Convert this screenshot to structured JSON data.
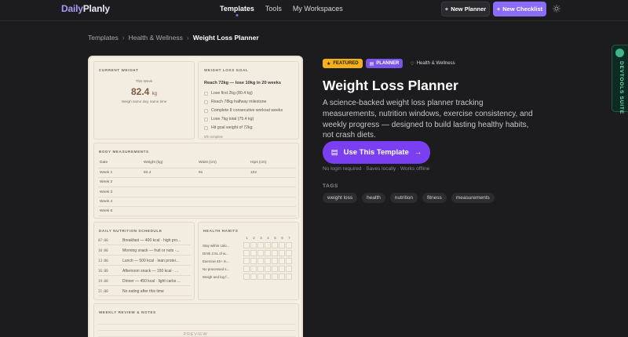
{
  "brand": {
    "part1": "Daily",
    "part2": "Planly"
  },
  "nav": {
    "links": [
      "Templates",
      "Tools",
      "My Workspaces"
    ],
    "new_planner": "New Planner",
    "new_checklist": "New Checklist"
  },
  "breadcrumb": [
    "Templates",
    "Health & Wellness",
    "Weight Loss Planner"
  ],
  "preview": {
    "current_weight": {
      "title": "CURRENT WEIGHT",
      "label": "This Week",
      "value": "82.4",
      "unit": "kg",
      "note": "Weigh same day, same time"
    },
    "goal": {
      "title": "WEIGHT LOSS GOAL",
      "headline": "Reach 72kg — lose 10kg in 20 weeks",
      "items": [
        "Lose first 2kg (80.4 kg)",
        "Reach 78kg halfway milestone",
        "Complete 8 consecutive workout weeks",
        "Lose 7kg total (75.4 kg)",
        "Hit goal weight of 72kg"
      ],
      "footer": "0/5 complete"
    },
    "measurements": {
      "title": "BODY MEASUREMENTS",
      "headers": [
        "Date",
        "Weight (kg)",
        "Waist (cm)",
        "Hips (cm)"
      ],
      "rows": [
        [
          "Week 1",
          "82.4",
          "91",
          "102"
        ],
        [
          "Week 2",
          "",
          "",
          ""
        ],
        [
          "Week 3",
          "",
          "",
          ""
        ],
        [
          "Week 4",
          "",
          "",
          ""
        ],
        [
          "Week 6",
          "",
          "",
          ""
        ]
      ]
    },
    "nutrition": {
      "title": "DAILY NUTRITION SCHEDULE",
      "rows": [
        {
          "time": "07:00",
          "text": "Breakfast — 400 kcal · high pro..."
        },
        {
          "time": "10:00",
          "text": "Morning snack — fruit or nuts ·..."
        },
        {
          "time": "13:00",
          "text": "Lunch — 500 kcal · lean protei..."
        },
        {
          "time": "16:00",
          "text": "Afternoon snack — 150 kcal · ..."
        },
        {
          "time": "19:00",
          "text": "Dinner — 450 kcal · light carbs ..."
        },
        {
          "time": "21:00",
          "text": "No eating after this time"
        }
      ]
    },
    "habits": {
      "title": "HEALTH HABITS",
      "days": [
        "1",
        "2",
        "3",
        "4",
        "5",
        "6",
        "7"
      ],
      "rows": [
        "Stay within calo...",
        "Drink 2.5L of w...",
        "Exercise 45+ m...",
        "No processed s...",
        "Weigh and log f..."
      ]
    },
    "review": {
      "title": "WEEKLY REVIEW & NOTES"
    },
    "watermark": "PREVIEW"
  },
  "detail": {
    "badges": {
      "featured": "FEATURED",
      "planner": "PLANNER",
      "category": "Health & Wellness"
    },
    "title": "Weight Loss Planner",
    "description": "A science-backed weight loss planner tracking measurements, nutrition windows, exercise consistency, and weekly progress — designed to build lasting healthy habits, not crash diets.",
    "cta": "Use This Template",
    "cta_sub": "No login required · Saves locally · Works offline",
    "tags_label": "TAGS",
    "tags": [
      "weight loss",
      "health",
      "nutrition",
      "fitness",
      "measurements"
    ]
  },
  "devtools": {
    "label": "DEVTOOLS SUITE"
  },
  "colors": {
    "accent": "#8b6cf6",
    "cta": "#7b3ff2",
    "featured": "#f3b11d",
    "background": "#1c1b1d"
  }
}
